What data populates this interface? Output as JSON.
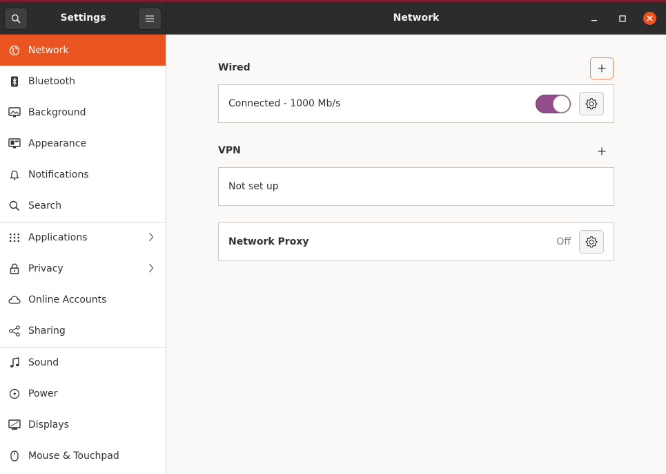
{
  "window": {
    "sidebar_title": "Settings",
    "page_title": "Network"
  },
  "colors": {
    "accent": "#e95420",
    "toggle_on": "#924d8b",
    "headerbar": "#2c2c2c"
  },
  "sidebar": {
    "items": [
      {
        "label": "Network",
        "icon": "network-icon",
        "active": true
      },
      {
        "label": "Bluetooth",
        "icon": "bluetooth-icon"
      },
      {
        "label": "Background",
        "icon": "background-icon"
      },
      {
        "label": "Appearance",
        "icon": "appearance-icon"
      },
      {
        "label": "Notifications",
        "icon": "bell-icon"
      },
      {
        "label": "Search",
        "icon": "search-icon"
      },
      {
        "label": "Applications",
        "icon": "grid-icon",
        "chevron": true
      },
      {
        "label": "Privacy",
        "icon": "lock-icon",
        "chevron": true
      },
      {
        "label": "Online Accounts",
        "icon": "cloud-icon"
      },
      {
        "label": "Sharing",
        "icon": "share-icon"
      },
      {
        "label": "Sound",
        "icon": "music-note-icon"
      },
      {
        "label": "Power",
        "icon": "power-icon"
      },
      {
        "label": "Displays",
        "icon": "display-icon"
      },
      {
        "label": "Mouse & Touchpad",
        "icon": "mouse-icon"
      }
    ]
  },
  "main": {
    "wired": {
      "label": "Wired",
      "status": "Connected - 1000 Mb/s",
      "enabled": true
    },
    "vpn": {
      "label": "VPN",
      "status": "Not set up"
    },
    "proxy": {
      "label": "Network Proxy",
      "state": "Off"
    }
  }
}
